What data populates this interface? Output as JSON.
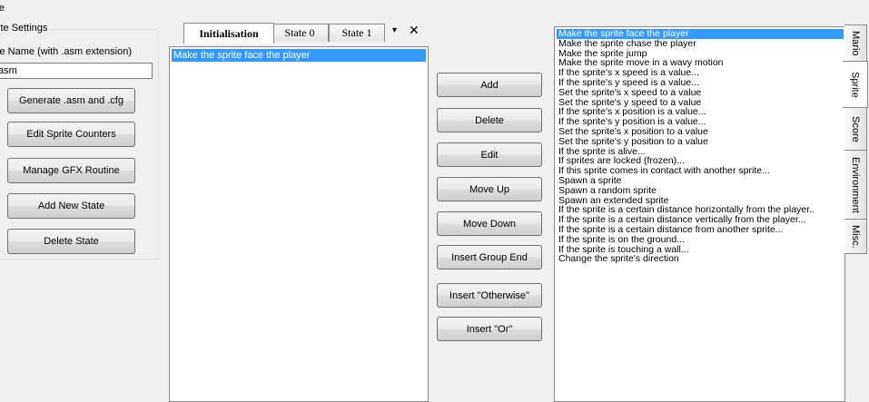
{
  "menu": {
    "file_label": "ile"
  },
  "settings": {
    "group_title": "ite Settings",
    "name_label": "ite Name (with .asm extension)",
    "name_value": ".asm",
    "buttons": [
      "Generate .asm and .cfg",
      "Edit Sprite Counters",
      "Manage GFX Routine",
      "Add New State",
      "Delete State"
    ]
  },
  "tabs": {
    "items": [
      "Initialisation",
      "State 0",
      "State 1"
    ],
    "dropdown_icon": "▾",
    "close_icon": "✕"
  },
  "state_list": {
    "items": [
      "Make the sprite face the player"
    ]
  },
  "actions": [
    "Add",
    "Delete",
    "Edit",
    "Move Up",
    "Move Down",
    "Insert Group End",
    "Insert \"Otherwise\"",
    "Insert \"Or\""
  ],
  "commands": [
    "Make the sprite face the player",
    "Make the sprite chase the player",
    "Make the sprite jump",
    "Make the sprite move in a wavy motion",
    "If the sprite's x speed is a value...",
    "If the sprite's y speed is a value...",
    "Set the sprite's x speed to a value",
    "Set the sprite's y speed to a value",
    "If the sprite's x position is a value...",
    "If the sprite's y position is a value...",
    "Set the sprite's x position to a value",
    "Set the sprite's y position to a value",
    "If the sprite is alive...",
    "If sprites are locked (frozen)...",
    "If this sprite comes in contact with another sprite...",
    "Spawn a sprite",
    "Spawn a random sprite",
    "Spawn an extended sprite",
    "If the sprite is a certain distance horizontally from the player..",
    "If the sprite is a certain distance vertically from the player...",
    "If the sprite is a certain distance from another sprite...",
    "If the sprite is on the ground...",
    "If the sprite is touching a wall...",
    "Change the sprite's direction"
  ],
  "side_tabs": [
    "Mario",
    "Sprite",
    "Score",
    "Environment",
    "Misc."
  ],
  "colors": {
    "selection": "#3399ff",
    "background": "#f0f0f0"
  }
}
